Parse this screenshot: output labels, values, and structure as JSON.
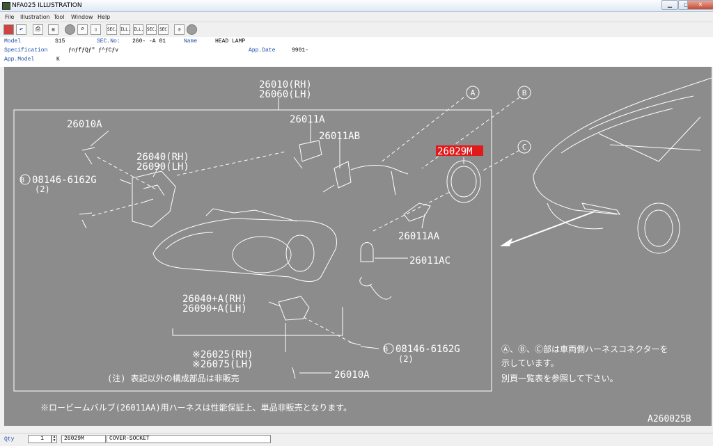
{
  "window": {
    "title": "NFA025  ILLUSTRATION",
    "min": "▁",
    "max": "□",
    "close": "✕"
  },
  "menu": {
    "file": "File",
    "illustration": "Illustration",
    "tool": "Tool",
    "window": "Window",
    "help": "Help"
  },
  "toolbar": {
    "sec": "SEC.",
    "ill": "ILL.",
    "next_ill": "ILL.",
    "prev_sec": "SEC.",
    "sec2": "SEC"
  },
  "info": {
    "model_label": "Model",
    "model_value": "S15",
    "secno_label": "SEC.No:",
    "secno_value": "260-  -A 01",
    "name_label": "Name",
    "name_value": "HEAD LAMP",
    "spec_label": "Specification",
    "spec_value": "ƒnƒfƒQƒ\" ƒ^ƒCƒv",
    "appdate_label": "App.Date",
    "appdate_value": "9901-",
    "appmodel_label": "App.Model",
    "appmodel_value": "K"
  },
  "diagram": {
    "top_rh": "26010(RH)",
    "top_lh": "26060(LH)",
    "p26010A": "26010A",
    "p26011A": "26011A",
    "p26011AB": "26011AB",
    "p26029M": "26029M",
    "p26040_rh": "26040(RH)",
    "p26090_lh": "26090(LH)",
    "bolt_b_left": "08146-6162G",
    "bolt_b_left_qty": "(2)",
    "p26011AA": "26011AA",
    "p26011AC": "26011AC",
    "p26040A_rh": "26040+A(RH)",
    "p26090A_lh": "26090+A(LH)",
    "bolt_b_right": "08146-6162G",
    "bolt_b_right_qty": "(2)",
    "p26025_rh": "※26025(RH)",
    "p26075_lh": "※26075(LH)",
    "note_not_sold": "(注) 表記以外の構成部品は非販売",
    "p26010A_bottom": "26010A",
    "footnote": "※ロービームバルブ(26011AA)用ハーネスは性能保証上、単品非販売となります。",
    "note_right_1": "Ⓐ、Ⓑ、Ⓒ部は車両側ハーネスコネクターを",
    "note_right_2": "示しています。",
    "note_right_3": "別頁一覧表を参照して下さい。",
    "callout_a": "A",
    "callout_b": "B",
    "callout_c": "C",
    "callout_b_small": "B",
    "figure_id": "A260025B"
  },
  "bottom": {
    "qty_label": "Qty",
    "qty_value": "1",
    "part_no": "26029M",
    "part_name": "COVER-SOCKET"
  },
  "colors": {
    "canvas": "#8c8c8c",
    "highlight": "#e0191b",
    "label_blue": "#1c4fa8"
  }
}
